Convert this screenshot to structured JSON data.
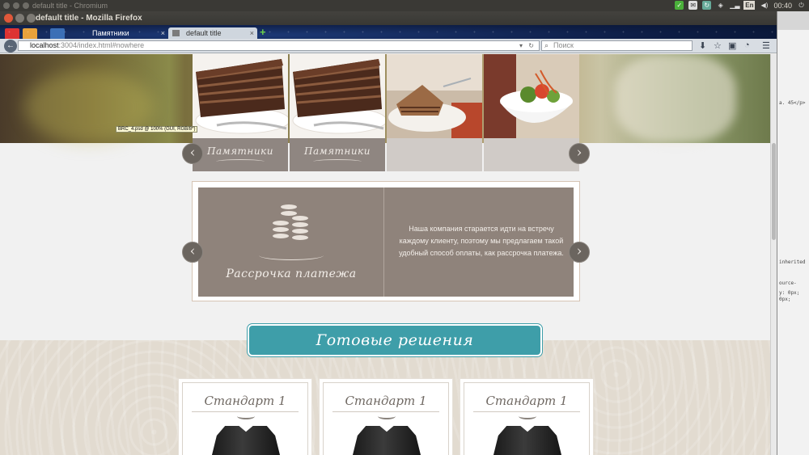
{
  "os_panel": {
    "background_window_title": "default title - Chromium",
    "clock": "00:40",
    "language": "En"
  },
  "firefox": {
    "window_title": "default title - Mozilla Firefox",
    "tabs": [
      {
        "label": "Памятники"
      },
      {
        "label": "default title"
      }
    ],
    "url": {
      "host": "localhost",
      "rest": ":3004/index.html#nowhere"
    },
    "search_placeholder": "Поиск",
    "tooltip": "BRC_4.psd @ 100% (GUI, RGB/8*)"
  },
  "page": {
    "gallery": [
      {
        "label": "Памятники",
        "image": "cake-slice"
      },
      {
        "label": "Памятники",
        "image": "cake-slice"
      },
      {
        "label": "",
        "image": "cake-plate"
      },
      {
        "label": "",
        "image": "salad-bowl"
      }
    ],
    "installment": {
      "title": "Рассрочка платежа",
      "text": "Наша компания старается идти на встречу каждому клиенту, поэтому мы предлагаем такой удобный способ оплаты, как рассрочка платежа."
    },
    "solutions_heading": "Готовые решения",
    "cards": [
      {
        "title": "Стандарт 1"
      },
      {
        "title": "Стандарт 1"
      },
      {
        "title": "Стандарт 1"
      }
    ]
  },
  "devtools_fragments": {
    "line1": "a. 45</p>",
    "line2": "inherited",
    "line3": "ource-",
    "line4": "y: 0px;",
    "line5": "0px;"
  },
  "colors": {
    "accent_teal": "#3e9ea9",
    "panel_taupe": "#8f837b",
    "paper_beige": "#e2dbd0"
  }
}
